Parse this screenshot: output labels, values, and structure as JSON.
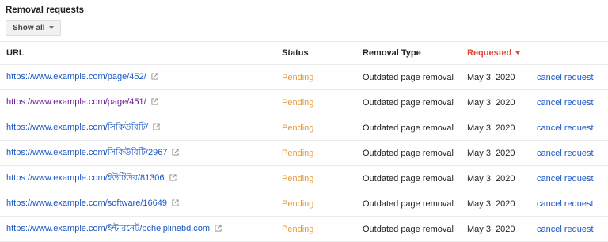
{
  "header": {
    "title": "Removal requests",
    "filter_label": "Show all"
  },
  "table": {
    "columns": {
      "url": "URL",
      "status": "Status",
      "removal_type": "Removal Type",
      "requested": "Requested"
    },
    "sorted_column": "requested",
    "rows": [
      {
        "url": "https://www.example.com/page/452/",
        "visited": false,
        "status": "Pending",
        "type": "Outdated page removal",
        "date": "May 3, 2020",
        "action": "cancel request"
      },
      {
        "url": "https://www.example.com/page/451/",
        "visited": true,
        "status": "Pending",
        "type": "Outdated page removal",
        "date": "May 3, 2020",
        "action": "cancel request"
      },
      {
        "url": "https://www.example.com/সিকিউরিটি/",
        "visited": false,
        "status": "Pending",
        "type": "Outdated page removal",
        "date": "May 3, 2020",
        "action": "cancel request"
      },
      {
        "url": "https://www.example.com/সিকিউরিটি/2967",
        "visited": false,
        "status": "Pending",
        "type": "Outdated page removal",
        "date": "May 3, 2020",
        "action": "cancel request"
      },
      {
        "url": "https://www.example.com/ইউটিউব/81306",
        "visited": false,
        "status": "Pending",
        "type": "Outdated page removal",
        "date": "May 3, 2020",
        "action": "cancel request"
      },
      {
        "url": "https://www.example.com/software/16649",
        "visited": false,
        "status": "Pending",
        "type": "Outdated page removal",
        "date": "May 3, 2020",
        "action": "cancel request"
      },
      {
        "url": "https://www.example.com/ইন্টারনেট/pchelplinebd.com",
        "visited": false,
        "status": "Pending",
        "type": "Outdated page removal",
        "date": "May 3, 2020",
        "action": "cancel request"
      }
    ]
  },
  "colors": {
    "link": "#1a57c4",
    "visited_link": "#6a1b9a",
    "pending": "#e59a3a",
    "sort_active": "#dd4b39"
  },
  "icons": {
    "external_link": "external-link-icon",
    "dropdown": "chevron-down-icon",
    "sort": "sort-descending-icon"
  }
}
